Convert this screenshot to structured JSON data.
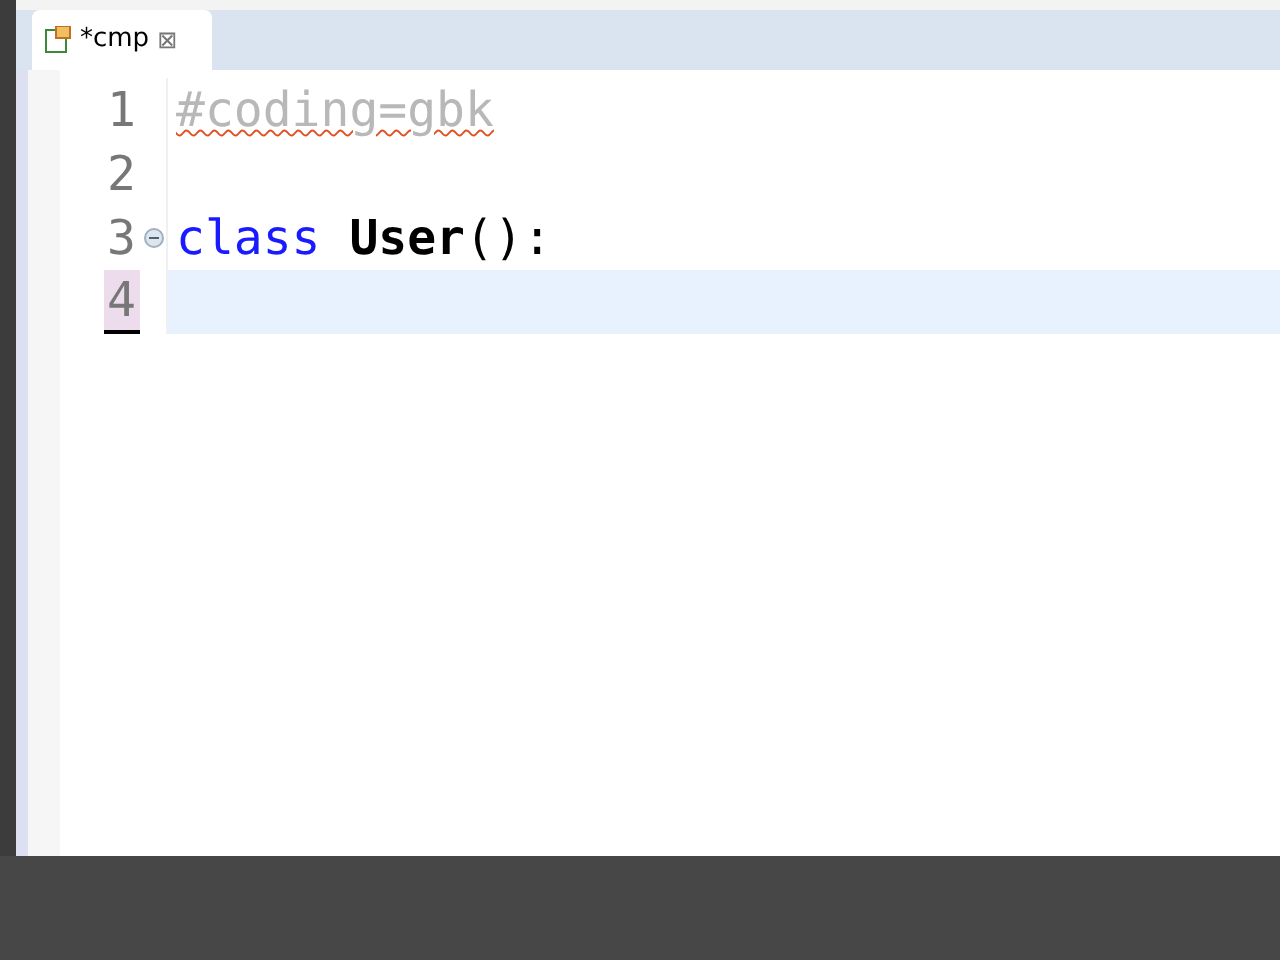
{
  "tab": {
    "title": "*cmp",
    "close": "⊠"
  },
  "lines": [
    {
      "number": "1",
      "current": false,
      "foldable": false,
      "tokens": [
        {
          "kind": "comment",
          "text": "#coding=gbk",
          "squiggle": true
        }
      ]
    },
    {
      "number": "2",
      "current": false,
      "foldable": false
    },
    {
      "number": "3",
      "current": false,
      "foldable": true,
      "tokens": [
        {
          "kind": "keyword",
          "text": "class "
        },
        {
          "kind": "classname",
          "text": "User"
        },
        {
          "kind": "punct",
          "text": "():"
        }
      ]
    },
    {
      "number": "4",
      "current": true,
      "foldable": false
    }
  ]
}
